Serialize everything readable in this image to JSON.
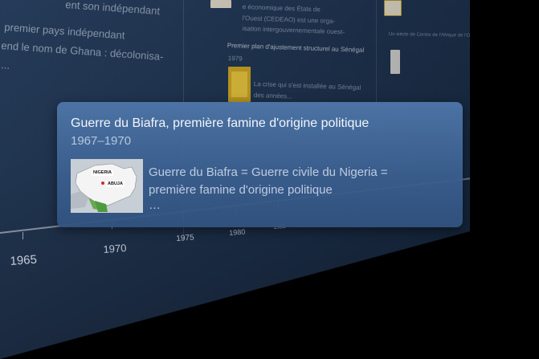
{
  "background": {
    "left_column": {
      "heading": "ent son indépendant",
      "lines": [
        "premier pays indépendant",
        "end le nom de Ghana : décolonisa-",
        "..."
      ]
    },
    "middle_column": {
      "top_lines": [
        "e économique des États de",
        "l'Ouest (CEDEAO) est une orga-",
        "isation intergouvernementale ouest-"
      ],
      "item_title": "Premier plan d'ajustement structurel au Sénégal",
      "item_year": "1979",
      "item_lines": [
        "La crise qui s'est installée au Sénégal",
        "des années..."
      ]
    },
    "right_column": {
      "item_title": "Un siècle de Centre de l'Afrique de l'Ouest"
    }
  },
  "timeline": {
    "years": [
      "1965",
      "1970",
      "1975",
      "1980",
      "1985"
    ]
  },
  "tooltip": {
    "title": "Guerre du Biafra, première famine d'origine politique",
    "dates": "1967–1970",
    "description_line1": "Guerre du Biafra = Guerre civile du Nigeria =",
    "description_line2": "première famine d'origine politique",
    "ellipsis": "…",
    "map_labels": {
      "country": "NIGERIA",
      "capital": "ABUJA"
    }
  },
  "colors": {
    "panel": "#1a2f4b",
    "card": "#4e76a8",
    "map_land": "#f4f4f4",
    "map_green": "#4f9a3f"
  }
}
